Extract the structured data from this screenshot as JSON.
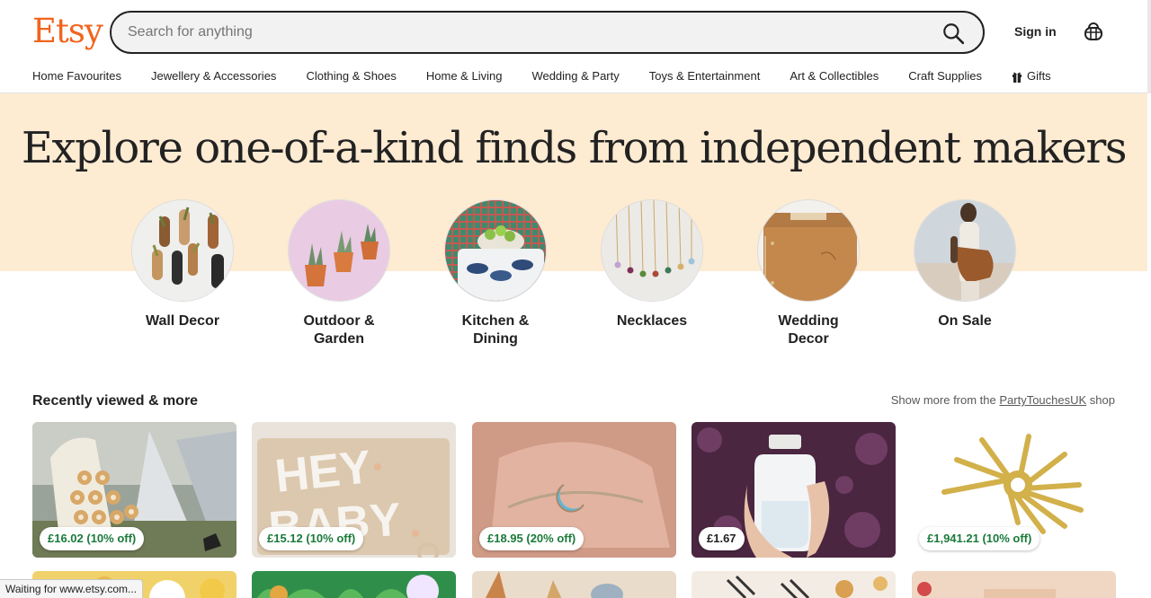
{
  "brand": {
    "logo": "Etsy",
    "color": "#F1641E"
  },
  "search": {
    "placeholder": "Search for anything",
    "value": ""
  },
  "header": {
    "signin": "Sign in"
  },
  "nav": [
    "Home Favourites",
    "Jewellery & Accessories",
    "Clothing & Shoes",
    "Home & Living",
    "Wedding & Party",
    "Toys & Entertainment",
    "Art & Collectibles",
    "Craft Supplies",
    "Gifts"
  ],
  "hero": {
    "title": "Explore one-of-a-kind finds from independent makers",
    "categories": [
      {
        "label": "Wall Decor"
      },
      {
        "label": "Outdoor & Garden"
      },
      {
        "label": "Kitchen & Dining"
      },
      {
        "label": "Necklaces"
      },
      {
        "label": "Wedding Decor"
      },
      {
        "label": "On Sale"
      }
    ]
  },
  "recent": {
    "title": "Recently viewed & more",
    "more_prefix": "Show more from the ",
    "more_link": "PartyTouchesUK",
    "more_suffix": " shop",
    "items": [
      {
        "price": "£16.02 (10% off)",
        "sale": true
      },
      {
        "price": "£15.12 (10% off)",
        "sale": true
      },
      {
        "price": "£18.95 (20% off)",
        "sale": true
      },
      {
        "price": "£1.67",
        "sale": false
      },
      {
        "price": "£1,941.21 (10% off)",
        "sale": true
      }
    ]
  },
  "status_bar": "Waiting for www.etsy.com..."
}
